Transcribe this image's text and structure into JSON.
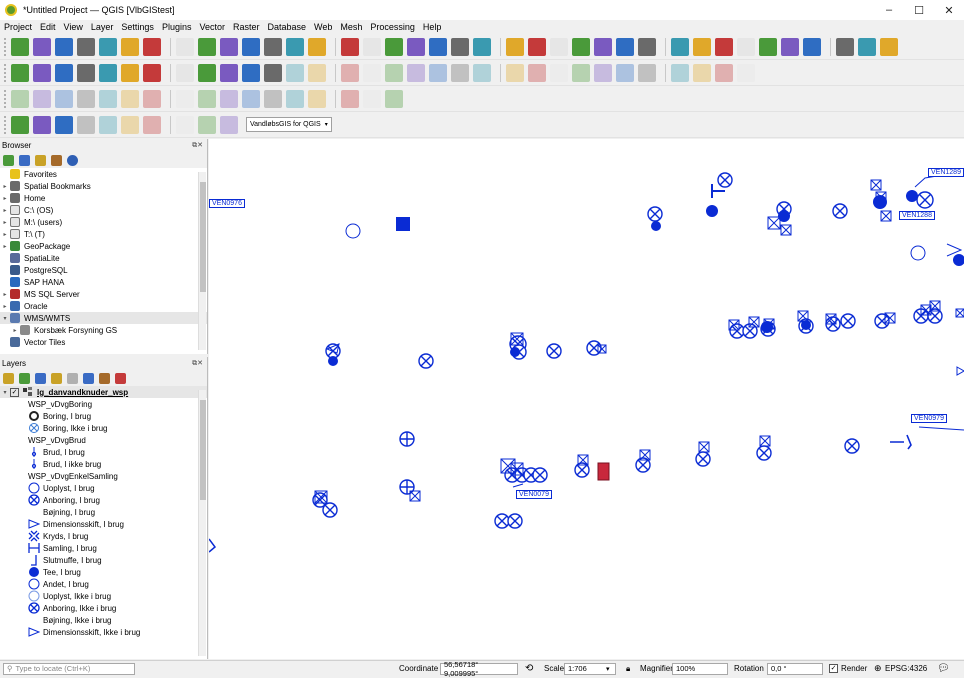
{
  "window": {
    "title": "*Untitled Project — QGIS [VlbGIStest]",
    "minimize": "–",
    "maximize": "☐",
    "close": "✕"
  },
  "menu": [
    "Project",
    "Edit",
    "View",
    "Layer",
    "Settings",
    "Plugins",
    "Vector",
    "Raster",
    "Database",
    "Web",
    "Mesh",
    "Processing",
    "Help"
  ],
  "toolbar": {
    "plugin_combo": "VandløbsGIS for QGIS"
  },
  "browser": {
    "title": "Browser",
    "items": [
      {
        "label": "Favorites",
        "icon": "star-icon",
        "expander": ""
      },
      {
        "label": "Spatial Bookmarks",
        "icon": "bookmark-icon",
        "expander": "▸"
      },
      {
        "label": "Home",
        "icon": "home-icon",
        "expander": "▸"
      },
      {
        "label": "C:\\ (OS)",
        "icon": "folder-icon",
        "expander": "▸"
      },
      {
        "label": "M:\\ (users)",
        "icon": "folder-icon",
        "expander": "▸"
      },
      {
        "label": "T:\\ (T)",
        "icon": "folder-icon",
        "expander": "▸"
      },
      {
        "label": "GeoPackage",
        "icon": "geopackage-icon",
        "expander": "▸"
      },
      {
        "label": "SpatiaLite",
        "icon": "spatialite-icon",
        "expander": ""
      },
      {
        "label": "PostgreSQL",
        "icon": "postgresql-icon",
        "expander": ""
      },
      {
        "label": "SAP HANA",
        "icon": "saphana-icon",
        "expander": ""
      },
      {
        "label": "MS SQL Server",
        "icon": "mssql-icon",
        "expander": "▸"
      },
      {
        "label": "Oracle",
        "icon": "oracle-icon",
        "expander": "▸"
      },
      {
        "label": "WMS/WMTS",
        "icon": "wms-icon",
        "expander": "▾"
      },
      {
        "label": "Korsbæk Forsyning GS",
        "icon": "wms-child-icon",
        "expander": "▸"
      },
      {
        "label": "Vector Tiles",
        "icon": "vector-tiles-icon",
        "expander": ""
      }
    ]
  },
  "layers": {
    "title": "Layers",
    "items": [
      {
        "label": "lg_danvandknuder_wsp",
        "symbol": "layer",
        "bold": true
      },
      {
        "label": "WSP_vDvgBoring",
        "symbol": "none"
      },
      {
        "label": "Boring, I brug",
        "symbol": "ring-thick"
      },
      {
        "label": "Boring, Ikke i brug",
        "symbol": "ring-x-light"
      },
      {
        "label": "WSP_vDvgBrud",
        "symbol": "none"
      },
      {
        "label": "Brud, I brug",
        "symbol": "pin"
      },
      {
        "label": "Brud, I ikke brug",
        "symbol": "pin"
      },
      {
        "label": "WSP_vDvgEnkelSamling",
        "symbol": "none"
      },
      {
        "label": "Uoplyst, I brug",
        "symbol": "ring"
      },
      {
        "label": "Anboring, I brug",
        "symbol": "ring-x"
      },
      {
        "label": "Bøjning, I brug",
        "symbol": "blank"
      },
      {
        "label": "Dimensionsskift, I brug",
        "symbol": "triangle"
      },
      {
        "label": "Kryds, I brug",
        "symbol": "cross"
      },
      {
        "label": "Samling, I brug",
        "symbol": "h-bar"
      },
      {
        "label": "Slutmuffe, I brug",
        "symbol": "end"
      },
      {
        "label": "Tee, I brug",
        "symbol": "dot"
      },
      {
        "label": "Andet, I brug",
        "symbol": "ring"
      },
      {
        "label": "Uoplyst, Ikke i brug",
        "symbol": "ring-light"
      },
      {
        "label": "Anboring, Ikke i brug",
        "symbol": "ring-x"
      },
      {
        "label": "Bøjning, Ikke i brug",
        "symbol": "blank"
      },
      {
        "label": "Dimensionsskift, Ikke i brug",
        "symbol": "triangle"
      }
    ]
  },
  "map": {
    "labels": [
      "VEN0976",
      "VEN1289",
      "VEN1288",
      "VEN0979",
      "VEN0079"
    ],
    "color": "#0a2bd4"
  },
  "status": {
    "locate_placeholder": "Type to locate (Ctrl+K)",
    "coordinate_label": "Coordinate",
    "coordinate": "56,56718° 9,009995°",
    "scale_label": "Scale",
    "scale": "1:706",
    "magnifier_label": "Magnifier",
    "magnifier": "100%",
    "rotation_label": "Rotation",
    "rotation": "0,0 °",
    "render_label": "Render",
    "crs": "EPSG:4326"
  }
}
